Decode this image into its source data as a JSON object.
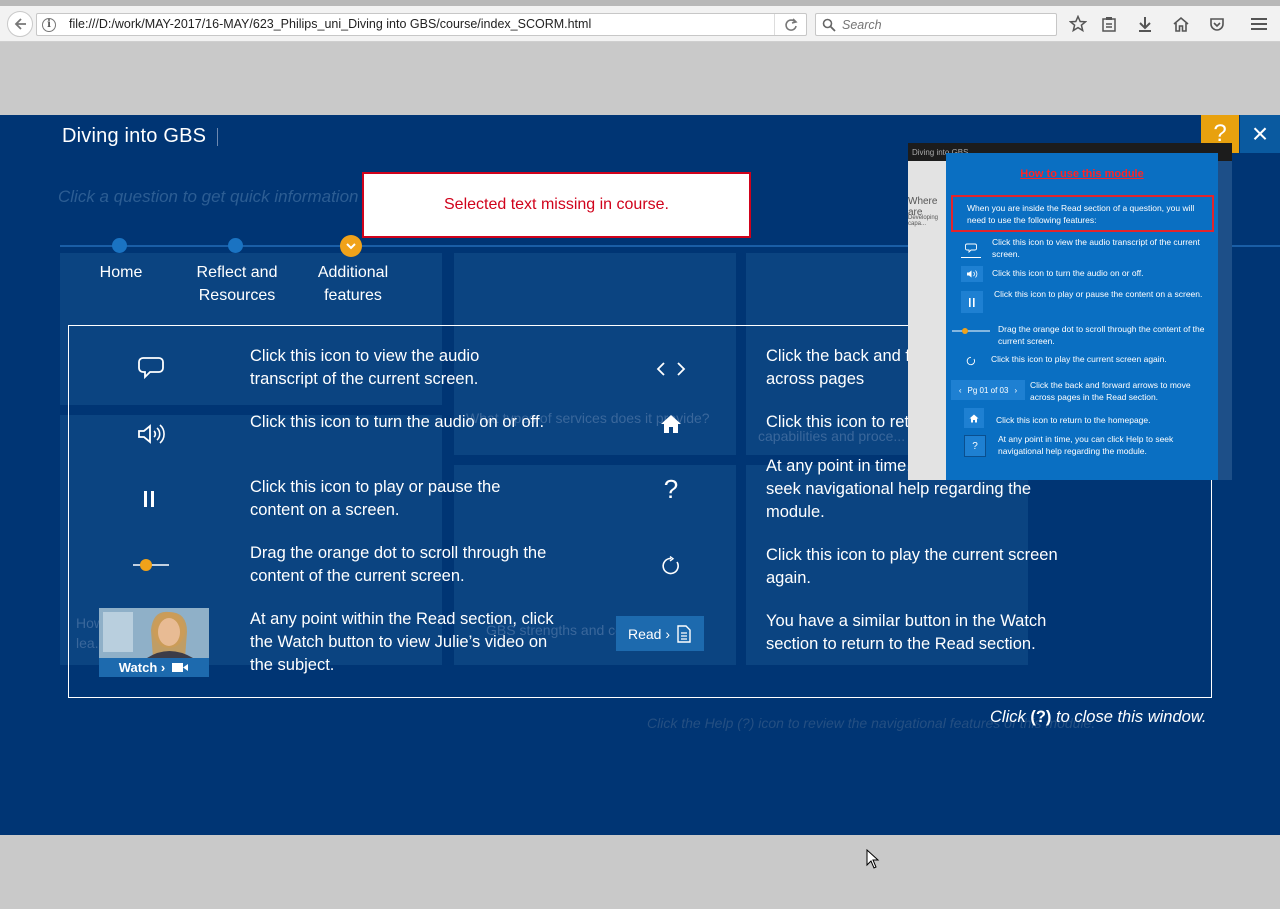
{
  "browser": {
    "url": "file:///D:/work/MAY-2017/16-MAY/623_Philips_uni_Diving into GBS/course/index_SCORM.html",
    "search_placeholder": "Search",
    "info_icon": "i"
  },
  "course": {
    "title": "Diving into GBS",
    "help_label": "?",
    "close_label": "×",
    "background_prompt": "Click a question to get quick information",
    "background_fragments": [
      "What types of services does it provide?",
      "capabilities and proce...",
      "GBS strengths and competence...",
      "How...",
      "lea... involve..."
    ],
    "error_message": "Selected text missing in course.",
    "nav": {
      "items": [
        {
          "label_line1": "Home",
          "label_line2": ""
        },
        {
          "label_line1": "Reflect and",
          "label_line2": "Resources"
        },
        {
          "label_line1": "Additional",
          "label_line2": "features"
        }
      ]
    },
    "help_rows_left": [
      {
        "icon": "transcript-icon",
        "text": "Click this icon to view the audio transcript of the current screen."
      },
      {
        "icon": "audio-icon",
        "text": "Click this icon to turn the audio on or off."
      },
      {
        "icon": "pause-icon",
        "text": "Click this icon to play or pause the content on a screen."
      },
      {
        "icon": "scrubber-icon",
        "text": "Drag the orange dot to scroll through the content of the current screen."
      },
      {
        "icon": "watch-button",
        "text": "At any point within the Read section, click the Watch button to view Julie’s video on the subject."
      }
    ],
    "help_rows_right": [
      {
        "icon": "back-forward-arrows-icon",
        "text": "Click the back and forward arrows to move across pages"
      },
      {
        "icon": "home-icon",
        "text": "Click this icon to return to the homepage."
      },
      {
        "icon": "help-icon",
        "text": "At any point in time, you can click Help to seek navigational help regarding the module."
      },
      {
        "icon": "replay-icon",
        "text": "Click this icon to play the current screen again."
      },
      {
        "icon": "read-button",
        "text": "You have a similar button in the Watch section to return to the Read section."
      }
    ],
    "watch_label": "Watch ›",
    "read_label": "Read ›",
    "close_hint_prefix": "Click ",
    "close_hint_symbol": "(?)",
    "close_hint_suffix": " to close this window.",
    "background_hint": "Click the Help (?) icon to review the navigational features of this module."
  },
  "preview": {
    "top_title": "Diving into GBS",
    "left_text_1": "Where are",
    "left_text_2": "Developing capa...",
    "heading": "How to use this module",
    "intro": "When you are inside the Read section of a question, you will need to use the following features:",
    "rows": [
      {
        "icon": "transcript-icon",
        "text": "Click this icon to view the audio transcript of the current screen."
      },
      {
        "icon": "audio-icon",
        "text": "Click this icon to turn the audio on or off."
      },
      {
        "icon": "pause-icon",
        "text": "Click this icon to play or pause the content on a screen."
      },
      {
        "icon": "scrubber-icon",
        "text": "Drag the orange dot to scroll through the content of the current screen."
      },
      {
        "icon": "replay-icon",
        "text": "Click this icon to play the current screen again."
      },
      {
        "icon": "page-nav",
        "text": "Click the back and forward arrows to move across pages in the Read section."
      },
      {
        "icon": "home-icon",
        "text": "Click this icon to return to the homepage."
      },
      {
        "icon": "help-icon",
        "text": "At any point in time, you can click Help to seek navigational help regarding the module."
      }
    ],
    "page_indicator": "Pg 01 of 03"
  },
  "colors": {
    "course_bg": "#003574",
    "accent_orange": "#f0a21a",
    "error_red": "#d0021b",
    "preview_blue": "#0a6fc2"
  }
}
